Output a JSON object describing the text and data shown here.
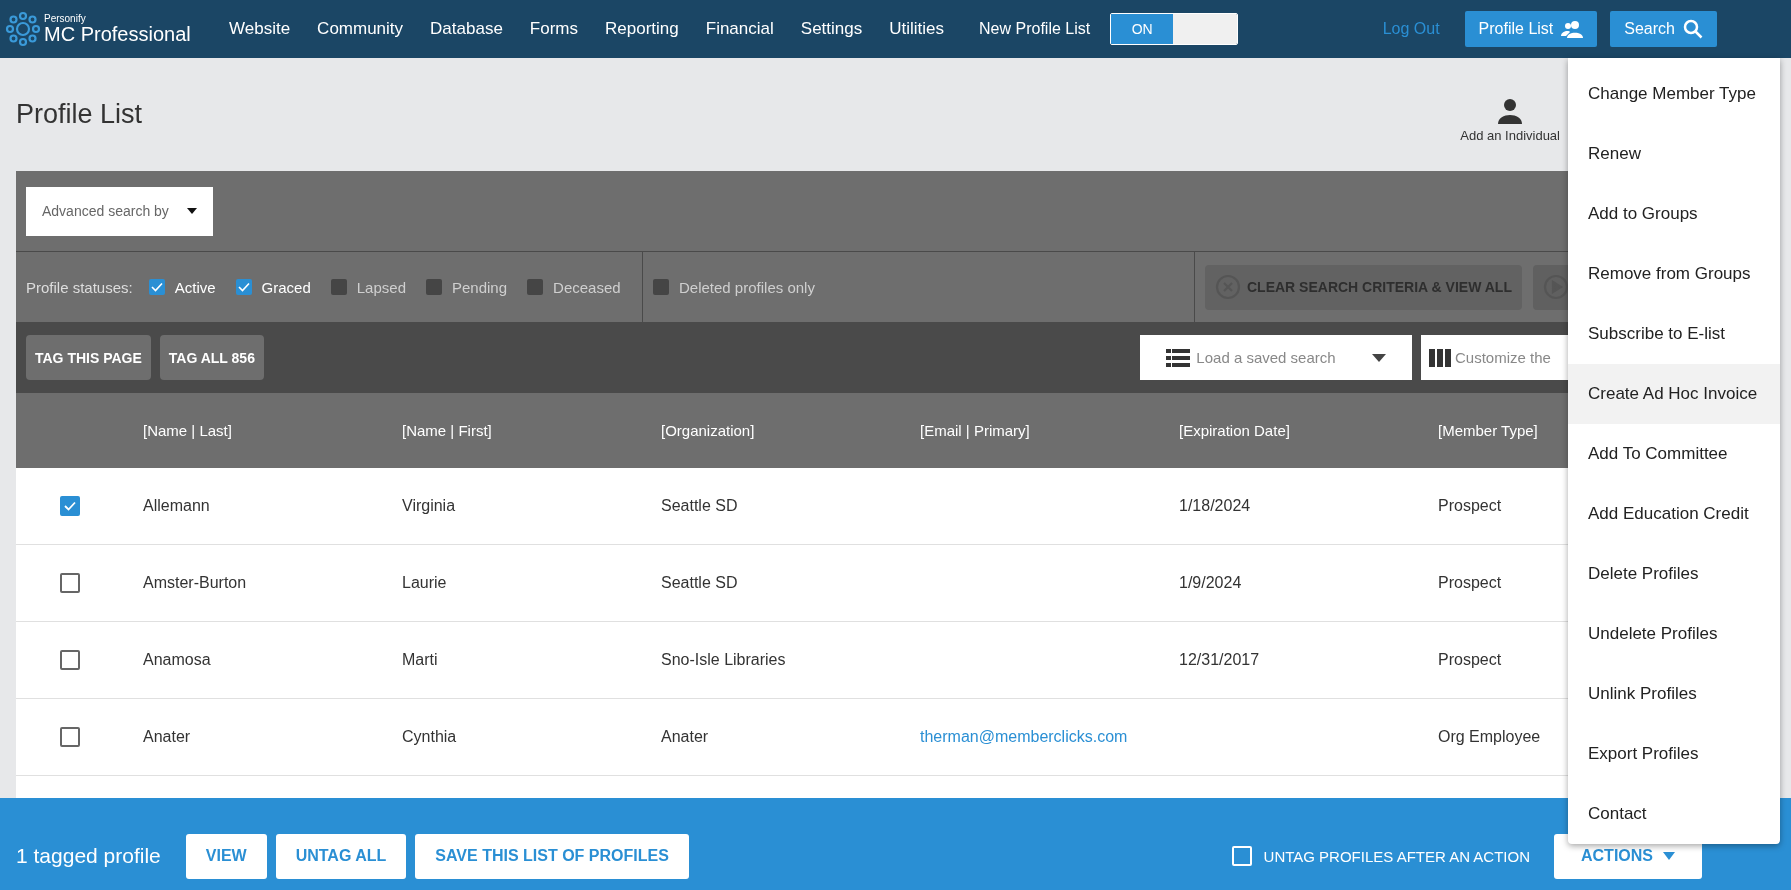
{
  "header": {
    "brand_small": "Personify",
    "brand": "MC Professional",
    "nav": [
      "Website",
      "Community",
      "Database",
      "Forms",
      "Reporting",
      "Financial",
      "Settings",
      "Utilities"
    ],
    "toggle": {
      "label": "New Profile List",
      "text": "ON",
      "on": true
    },
    "logout": "Log Out",
    "profile_list_button": "Profile List",
    "search_button": "Search"
  },
  "page_title": "Profile List",
  "add_individual": "Add an Individual",
  "advanced_search": "Advanced search by",
  "statuses": {
    "label": "Profile statuses:",
    "items": [
      {
        "label": "Active",
        "checked": true
      },
      {
        "label": "Graced",
        "checked": true
      },
      {
        "label": "Lapsed",
        "checked": false
      },
      {
        "label": "Pending",
        "checked": false
      },
      {
        "label": "Deceased",
        "checked": false
      }
    ],
    "deleted_only": {
      "label": "Deleted profiles only",
      "checked": false
    }
  },
  "clear_button": "CLEAR SEARCH CRITERIA & VIEW ALL",
  "tag_buttons": [
    "TAG THIS PAGE",
    "TAG ALL 856"
  ],
  "saved_search": "Load a saved search",
  "customize": "Customize the",
  "table": {
    "columns": [
      "[Name | Last]",
      "[Name | First]",
      "[Organization]",
      "[Email | Primary]",
      "[Expiration Date]",
      "[Member Type]"
    ],
    "rows": [
      {
        "checked": true,
        "last": "Allemann",
        "first": "Virginia",
        "organization": "Seattle SD",
        "expiration": "1/18/2024",
        "member_type": "Prospect"
      },
      {
        "checked": false,
        "last": "Amster-Burton",
        "first": "Laurie",
        "organization": "Seattle SD",
        "expiration": "1/9/2024",
        "member_type": "Prospect"
      },
      {
        "checked": false,
        "last": "Anamosa",
        "first": "Marti",
        "organization": "Sno-Isle Libraries",
        "expiration": "12/31/2017",
        "member_type": "Prospect"
      },
      {
        "checked": false,
        "last": "Anater",
        "first": "Cynthia",
        "organization": "Anater",
        "email": "therman@memberclicks.com",
        "member_type": "Org Employee"
      }
    ]
  },
  "footer": {
    "tagged": "1 tagged profile",
    "buttons": [
      "VIEW",
      "UNTAG ALL",
      "SAVE THIS LIST OF PROFILES"
    ],
    "untag_after": {
      "label": "UNTAG PROFILES AFTER AN ACTION",
      "checked": false
    },
    "actions": "ACTIONS"
  },
  "actions_menu": [
    {
      "label": "Change Member Type",
      "selected": false
    },
    {
      "label": "Renew",
      "selected": false
    },
    {
      "label": "Add to Groups",
      "selected": false
    },
    {
      "label": "Remove from Groups",
      "selected": false
    },
    {
      "label": "Subscribe to E-list",
      "selected": false
    },
    {
      "label": "Create Ad Hoc Invoice",
      "selected": true
    },
    {
      "label": "Add To Committee",
      "selected": false
    },
    {
      "label": "Add Education Credit",
      "selected": false
    },
    {
      "label": "Delete Profiles",
      "selected": false
    },
    {
      "label": "Undelete Profiles",
      "selected": false
    },
    {
      "label": "Unlink Profiles",
      "selected": false
    },
    {
      "label": "Export Profiles",
      "selected": false
    },
    {
      "label": "Contact",
      "selected": false
    }
  ]
}
